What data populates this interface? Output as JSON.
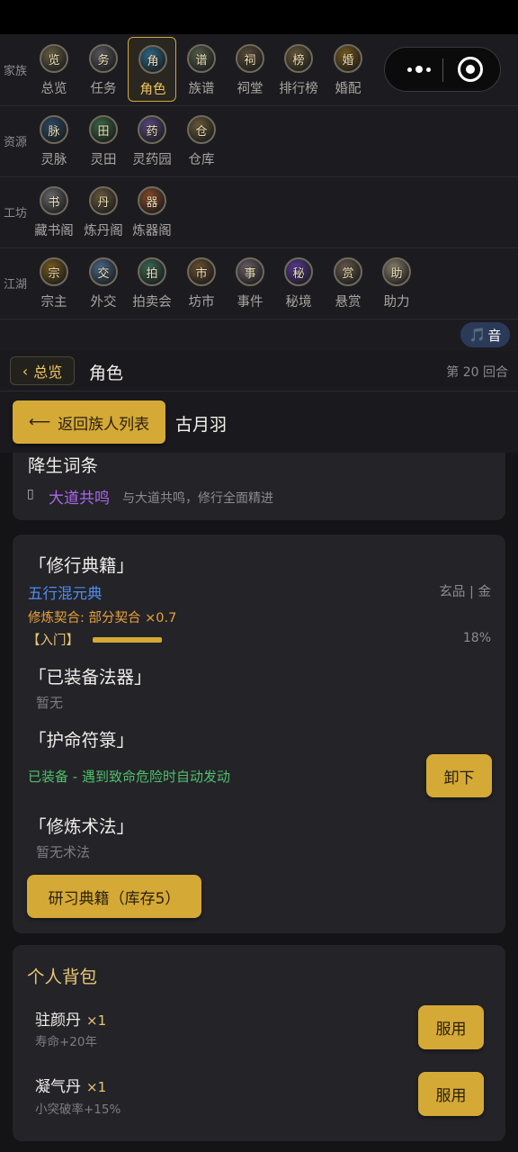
{
  "nav": {
    "categories": [
      {
        "label": "家族",
        "items": [
          {
            "label": "总览",
            "icon": "overview-icon",
            "glyph": "览",
            "color": "#6a6146"
          },
          {
            "label": "任务",
            "icon": "task-icon",
            "glyph": "务",
            "color": "#5a5a62"
          },
          {
            "label": "角色",
            "icon": "character-icon",
            "glyph": "角",
            "color": "#2e6a8a"
          },
          {
            "label": "族谱",
            "icon": "genealogy-icon",
            "glyph": "谱",
            "color": "#55604a"
          },
          {
            "label": "祠堂",
            "icon": "shrine-icon",
            "glyph": "祠",
            "color": "#5c4d3a"
          },
          {
            "label": "排行榜",
            "icon": "ranking-icon",
            "glyph": "榜",
            "color": "#6b5a3a"
          },
          {
            "label": "婚配",
            "icon": "marriage-icon",
            "glyph": "婚",
            "color": "#7a5c20"
          }
        ]
      },
      {
        "label": "资源",
        "items": [
          {
            "label": "灵脉",
            "icon": "spirit-vein-icon",
            "glyph": "脉",
            "color": "#2c4a6a"
          },
          {
            "label": "灵田",
            "icon": "spirit-field-icon",
            "glyph": "田",
            "color": "#3b6a46"
          },
          {
            "label": "灵药园",
            "icon": "herb-garden-icon",
            "glyph": "药",
            "color": "#5b4a82"
          },
          {
            "label": "仓库",
            "icon": "warehouse-icon",
            "glyph": "仓",
            "color": "#6a5a3a"
          }
        ]
      },
      {
        "label": "工坊",
        "items": [
          {
            "label": "藏书阁",
            "icon": "library-icon",
            "glyph": "书",
            "color": "#6a6a70"
          },
          {
            "label": "炼丹阁",
            "icon": "alchemy-icon",
            "glyph": "丹",
            "color": "#6a5a42"
          },
          {
            "label": "炼器阁",
            "icon": "forge-icon",
            "glyph": "器",
            "color": "#8a4a2a"
          }
        ]
      },
      {
        "label": "江湖",
        "items": [
          {
            "label": "宗主",
            "icon": "sect-master-icon",
            "glyph": "宗",
            "color": "#7a5c20"
          },
          {
            "label": "外交",
            "icon": "diplomacy-icon",
            "glyph": "交",
            "color": "#4a6a8a"
          },
          {
            "label": "拍卖会",
            "icon": "auction-icon",
            "glyph": "拍",
            "color": "#3b6a56"
          },
          {
            "label": "坊市",
            "icon": "market-icon",
            "glyph": "市",
            "color": "#6b5030"
          },
          {
            "label": "事件",
            "icon": "event-icon",
            "glyph": "事",
            "color": "#6a6068"
          },
          {
            "label": "秘境",
            "icon": "secret-realm-icon",
            "glyph": "秘",
            "color": "#5a3a9a"
          },
          {
            "label": "悬赏",
            "icon": "bounty-icon",
            "glyph": "赏",
            "color": "#6a5a50"
          },
          {
            "label": "助力",
            "icon": "assist-icon",
            "glyph": "助",
            "color": "#8a8270"
          }
        ]
      }
    ],
    "active": "角色"
  },
  "capsule": {
    "more_icon": "more-dots-icon",
    "close_icon": "close-target-icon"
  },
  "music": {
    "icon": "music-note-icon",
    "glyph": "🎵",
    "label": "音"
  },
  "subheader": {
    "back_glyph": "‹",
    "back_label": "总览",
    "title": "角色",
    "round": "第 20 回合"
  },
  "character": {
    "back_glyph": "⟵",
    "back_label": "返回族人列表",
    "name": "古月羽"
  },
  "birth": {
    "heading": "降生词条",
    "marker": "▯",
    "trait_name": "大道共鸣",
    "trait_desc": "与大道共鸣，修行全面精进"
  },
  "cultivation": {
    "scripture_heading": "「修行典籍」",
    "scripture_name": "五行混元典",
    "scripture_grade": "玄品 | 金",
    "affinity": "修炼契合: 部分契合 ×0.7",
    "stage": "【入门】",
    "progress_percent": 18,
    "progress_text": "18%",
    "artifact_heading": "「已装备法器」",
    "artifact_value": "暂无",
    "talisman_heading": "「护命符箓」",
    "talisman_status": "已装备 - 遇到致命危险时自动发动",
    "unequip_label": "卸下",
    "technique_heading": "「修炼术法」",
    "technique_value": "暂无术法",
    "study_label": "研习典籍（库存5）"
  },
  "bag": {
    "heading": "个人背包",
    "items": [
      {
        "name": "驻颜丹",
        "count": "×1",
        "desc": "寿命+20年",
        "action": "服用"
      },
      {
        "name": "凝气丹",
        "count": "×1",
        "desc": "小突破率+15%",
        "action": "服用"
      }
    ]
  },
  "colors": {
    "accent": "#d4a936",
    "accent_text": "#f0c760",
    "blue_link": "#4f8ef0",
    "purple": "#a868e8",
    "green": "#4fc06a",
    "orange": "#e8a23a"
  }
}
